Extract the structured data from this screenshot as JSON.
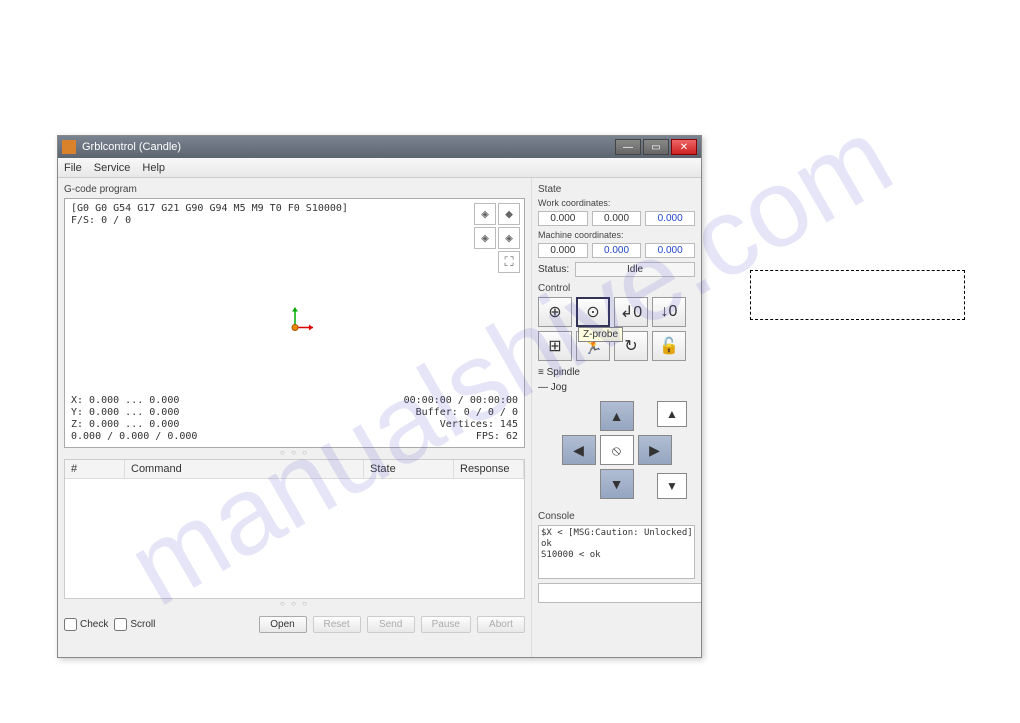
{
  "watermark": "manualshive.com",
  "window": {
    "title": "Grblcontrol (Candle)"
  },
  "menu": {
    "file": "File",
    "service": "Service",
    "help": "Help"
  },
  "gcode": {
    "label": "G-code program",
    "header_line1": "[G0 G0 G54 G17 G21 G90 G94 M5 M9 T0 F0 S10000]",
    "header_line2": "F/S: 0 / 0",
    "coords": "X: 0.000 ... 0.000\nY: 0.000 ... 0.000\nZ: 0.000 ... 0.000\n0.000 / 0.000 / 0.000",
    "stats": "00:00:00 / 00:00:00\nBuffer: 0 / 0 / 0\nVertices: 145\nFPS: 62"
  },
  "table": {
    "col_num": "#",
    "col_cmd": "Command",
    "col_state": "State",
    "col_resp": "Response"
  },
  "buttons": {
    "check": "Check",
    "scroll": "Scroll",
    "open": "Open",
    "reset": "Reset",
    "send": "Send",
    "pause": "Pause",
    "abort": "Abort"
  },
  "state": {
    "label": "State",
    "work_label": "Work coordinates:",
    "work": [
      "0.000",
      "0.000",
      "0.000"
    ],
    "machine_label": "Machine coordinates:",
    "machine": [
      "0.000",
      "0.000",
      "0.000"
    ],
    "status_label": "Status:",
    "status_value": "Idle"
  },
  "control": {
    "label": "Control",
    "tooltip": "Z-probe"
  },
  "spindle": {
    "label": "Spindle"
  },
  "jog": {
    "label": "Jog"
  },
  "console": {
    "label": "Console",
    "text": "$X < [MSG:Caution: Unlocked]\nok\nS10000 < ok"
  }
}
